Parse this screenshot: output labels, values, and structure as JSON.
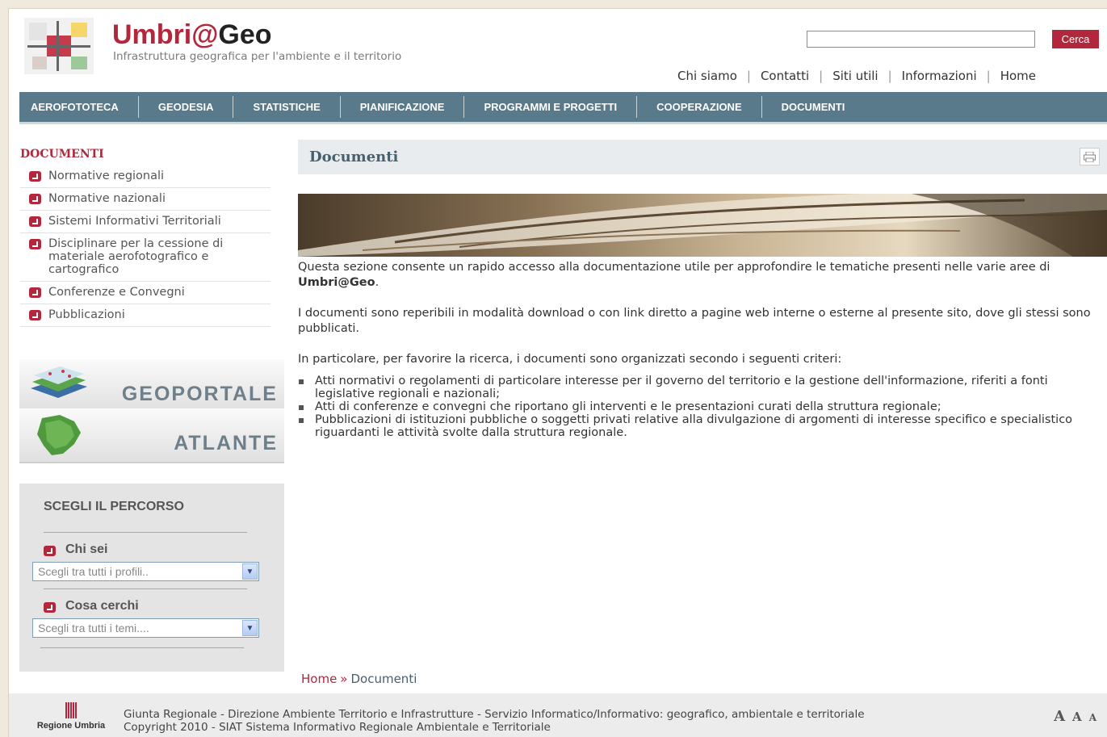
{
  "header": {
    "brand_part1": "Umbri@",
    "brand_part2": "Geo",
    "subtitle": "Infrastruttura geografica per l'ambiente e il territorio",
    "search_placeholder": "",
    "search_button": "Cerca",
    "top_links": [
      "Chi siamo",
      "Contatti",
      "Siti utili",
      "Informazioni",
      "Home"
    ]
  },
  "nav": [
    "AEROFOTOTECA",
    "GEODESIA",
    "STATISTICHE",
    "PIANIFICAZIONE",
    "PROGRAMMI E PROGETTI",
    "COOPERAZIONE",
    "DOCUMENTI"
  ],
  "sidebar": {
    "title": "DOCUMENTI",
    "items": [
      "Normative regionali",
      "Normative nazionali",
      "Sistemi Informativi Territoriali",
      "Disciplinare per la cessione di materiale aerofotografico e cartografico",
      "Conferenze e Convegni",
      "Pubblicazioni"
    ],
    "banner_geoportale": "GEOPORTALE",
    "banner_atlante": "ATLANTE",
    "percorso": {
      "title": "SCEGLI IL PERCORSO",
      "chi_sei": "Chi sei",
      "chi_sei_select": "Scegli tra tutti i profili..",
      "cosa_cerchi": "Cosa cerchi",
      "cosa_cerchi_select": "Scegli tra tutti i temi...."
    }
  },
  "content": {
    "title": "Documenti",
    "p1_text": "Questa sezione consente un rapido accesso alla documentazione utile per approfondire le tematiche presenti nelle varie aree di ",
    "p1_bold": "Umbri@Geo",
    "p1_end": ".",
    "p2": "I documenti sono reperibili in modalità download o con link diretto a pagine web interne o esterne al presente sito, dove gli stessi sono pubblicati.",
    "p3": "In particolare, per favorire la ricerca, i documenti sono organizzati secondo i seguenti criteri:",
    "bullets": [
      "Atti normativi o regolamenti di particolare interesse per il governo del territorio e la gestione dell'informazione, riferiti a fonti legislative regionali e nazionali;",
      "Atti di conferenze e convegni che riportano gli interventi e le presentazioni curati della struttura regionale;",
      "Pubblicazioni di istituzioni pubbliche o soggetti privati relative alla divulgazione di argomenti di interesse specifico e specialistico riguardanti le attività svolte dalla struttura regionale."
    ]
  },
  "breadcrumb": {
    "home": "Home",
    "sep": "»",
    "current": "Documenti"
  },
  "footer": {
    "logo_label": "Regione Umbria",
    "line1": "Giunta Regionale - Direzione Ambiente Territorio e Infrastrutture - Servizio Informatico/Informativo: geografico, ambientale e territoriale",
    "line2": "Copyright 2010 - SIAT Sistema Informativo Regionale Ambientale e Territoriale",
    "font_sizes": [
      "A",
      "A",
      "A"
    ]
  },
  "colors": {
    "brand_red": "#b3273d",
    "nav_bg": "#597a8a",
    "title_blue": "#48606e"
  }
}
